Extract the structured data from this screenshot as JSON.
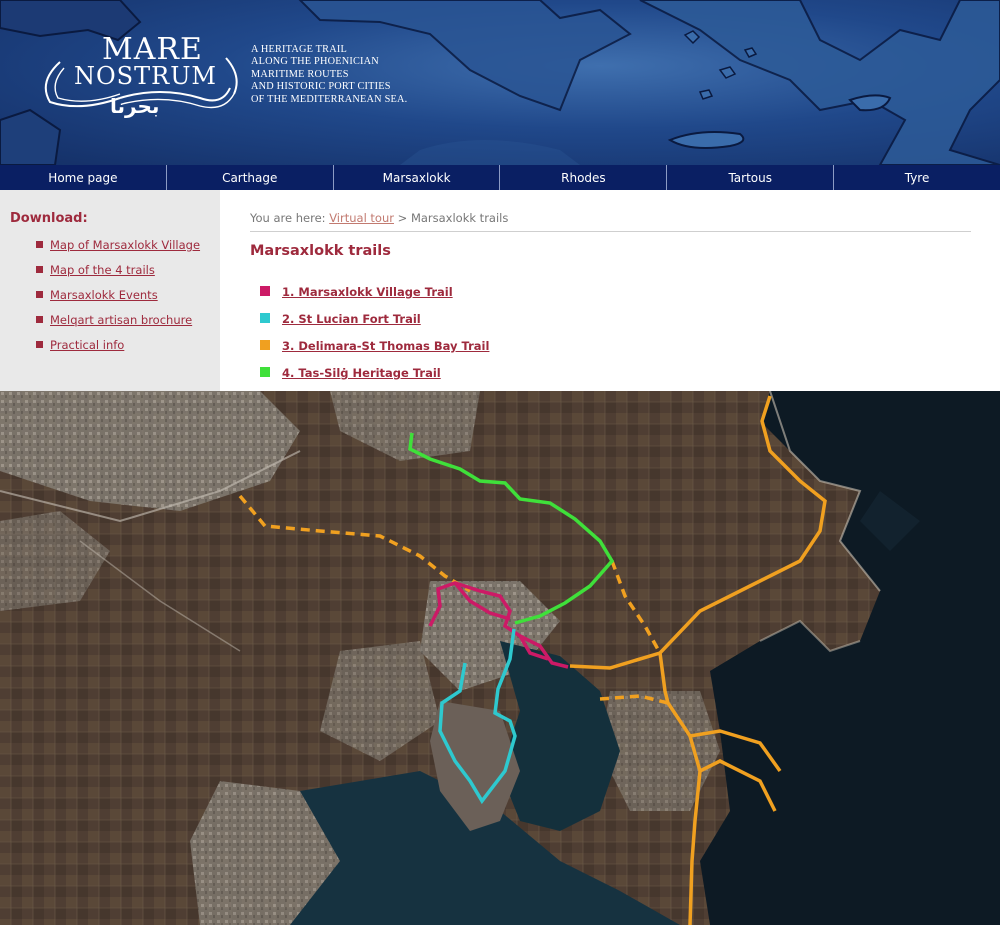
{
  "colors": {
    "nav_bg": "#0a1f63",
    "accent": "#9e2a3d",
    "sidebar_bg": "#e9e9e9",
    "trail_village": "#cc1a66",
    "trail_fort": "#2ec9cf",
    "trail_delimara": "#f0a020",
    "trail_tas_silg": "#3fe03a"
  },
  "header": {
    "logo_line1": "MARE",
    "logo_line2": "NOSTRUM",
    "logo_arabic": "بحرنا",
    "tagline": [
      "A HERITAGE TRAIL",
      "ALONG THE PHOENICIAN",
      "MARITIME ROUTES",
      "AND HISTORIC PORT CITIES",
      "OF THE MEDITERRANEAN SEA."
    ]
  },
  "nav": {
    "items": [
      "Home page",
      "Carthage",
      "Marsaxlokk",
      "Rhodes",
      "Tartous",
      "Tyre"
    ]
  },
  "sidebar": {
    "heading": "Download:",
    "links": [
      "Map of Marsaxlokk Village",
      "Map of the 4 trails",
      "Marsaxlokk Events",
      "Melqart artisan brochure",
      "Practical info"
    ]
  },
  "main": {
    "breadcrumb_prefix": "You are here: ",
    "breadcrumb_link": "Virtual tour",
    "breadcrumb_sep": " > ",
    "breadcrumb_current": "Marsaxlokk trails",
    "title": "Marsaxlokk trails",
    "trails": [
      {
        "label": "1. Marsaxlokk Village Trail",
        "color": "#cc1a66"
      },
      {
        "label": "2. St Lucian Fort Trail",
        "color": "#2ec9cf"
      },
      {
        "label": "3. Delimara-St Thomas Bay Trail",
        "color": "#f0a020"
      },
      {
        "label": "4. Tas-Silġ Heritage Trail",
        "color": "#3fe03a"
      }
    ]
  }
}
